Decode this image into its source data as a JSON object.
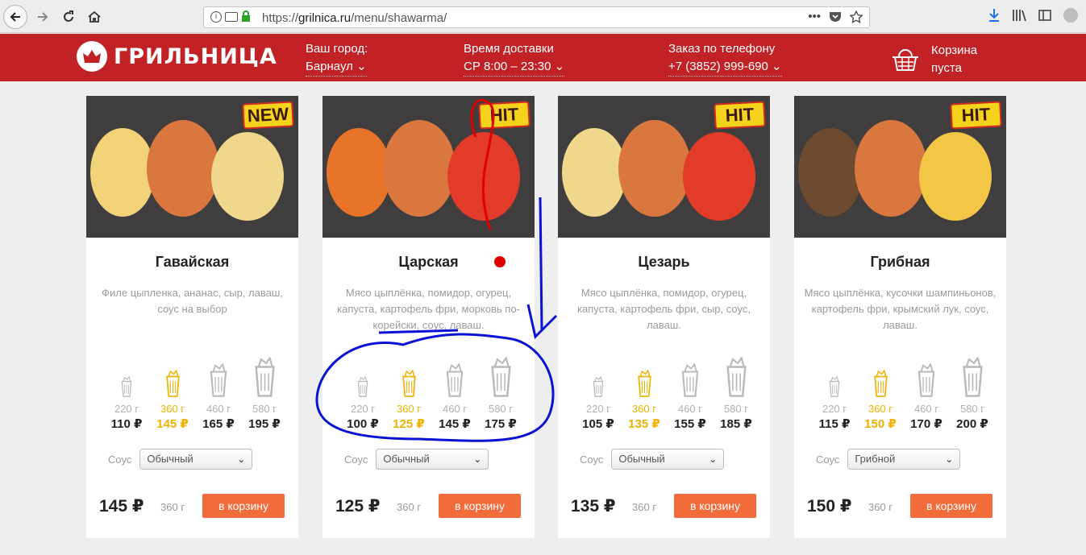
{
  "browser": {
    "url_prefix": "https://",
    "url_domain": "grilnica.ru",
    "url_path": "/menu/shawarma/",
    "url_more": "•••"
  },
  "header": {
    "logo_text": "ГРИЛЬНИЦА",
    "city_label": "Ваш город:",
    "city_value": "Барнаул",
    "delivery_label": "Время доставки",
    "delivery_value": "СР 8:00 – 23:30",
    "phone_label": "Заказ по телефону",
    "phone_value": "+7 (3852) 999-690",
    "cart_line1": "Корзина",
    "cart_line2": "пуста"
  },
  "colors": {
    "brand_red": "#c22226",
    "accent_yellow": "#f0b100",
    "button_orange": "#f26b3a",
    "annotation_blue": "#0a12d6",
    "annotation_red": "#e00000"
  },
  "products": [
    {
      "name": "Гавайская",
      "badge": "NEW",
      "desc": "Филе цыпленка, ананас, сыр, лаваш, соус на выбор",
      "sizes": [
        {
          "weight": "220 г",
          "price": "110 ₽"
        },
        {
          "weight": "360 г",
          "price": "145 ₽"
        },
        {
          "weight": "460 г",
          "price": "165 ₽"
        },
        {
          "weight": "580 г",
          "price": "195 ₽"
        }
      ],
      "sauce_label": "Соус",
      "sauce_value": "Обычный",
      "total": "145 ₽",
      "total_weight": "360 г",
      "button": "в корзину"
    },
    {
      "name": "Царская",
      "badge": "HIT",
      "desc": "Мясо цыплёнка, помидор, огурец, капуста, картофель фри, морковь по-корейски, соус, лаваш.",
      "sizes": [
        {
          "weight": "220 г",
          "price": "100 ₽"
        },
        {
          "weight": "360 г",
          "price": "125 ₽"
        },
        {
          "weight": "460 г",
          "price": "145 ₽"
        },
        {
          "weight": "580 г",
          "price": "175 ₽"
        }
      ],
      "sauce_label": "Соус",
      "sauce_value": "Обычный",
      "total": "125 ₽",
      "total_weight": "360 г",
      "button": "в корзину"
    },
    {
      "name": "Цезарь",
      "badge": "HIT",
      "desc": "Мясо цыплёнка, помидор, огурец, капуста, картофель фри, сыр, соус, лаваш.",
      "sizes": [
        {
          "weight": "220 г",
          "price": "105 ₽"
        },
        {
          "weight": "360 г",
          "price": "135 ₽"
        },
        {
          "weight": "460 г",
          "price": "155 ₽"
        },
        {
          "weight": "580 г",
          "price": "185 ₽"
        }
      ],
      "sauce_label": "Соус",
      "sauce_value": "Обычный",
      "total": "135 ₽",
      "total_weight": "360 г",
      "button": "в корзину"
    },
    {
      "name": "Грибная",
      "badge": "HIT",
      "desc": "Мясо цыплёнка, кусочки шампиньонов, картофель фри, крымский лук, соус, лаваш.",
      "sizes": [
        {
          "weight": "220 г",
          "price": "115 ₽"
        },
        {
          "weight": "360 г",
          "price": "150 ₽"
        },
        {
          "weight": "460 г",
          "price": "170 ₽"
        },
        {
          "weight": "580 г",
          "price": "200 ₽"
        }
      ],
      "sauce_label": "Соус",
      "sauce_value": "Грибной",
      "total": "150 ₽",
      "total_weight": "360 г",
      "button": "в корзину"
    }
  ]
}
